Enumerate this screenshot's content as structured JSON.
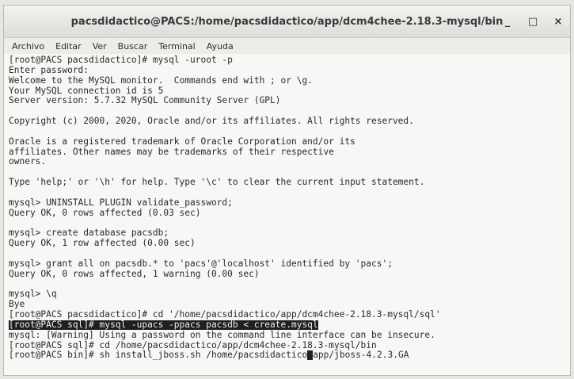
{
  "window": {
    "title": "pacsdidactico@PACS:/home/pacsdidactico/app/dcm4chee-2.18.3-mysql/bin",
    "minimize": "_",
    "maximize": "□",
    "close": "×"
  },
  "menu": [
    "Archivo",
    "Editar",
    "Ver",
    "Buscar",
    "Terminal",
    "Ayuda"
  ],
  "terminal": {
    "lines": [
      "[root@PACS pacsdidactico]# mysql -uroot -p",
      "Enter password:",
      "Welcome to the MySQL monitor.  Commands end with ; or \\g.",
      "Your MySQL connection id is 5",
      "Server version: 5.7.32 MySQL Community Server (GPL)",
      "",
      "Copyright (c) 2000, 2020, Oracle and/or its affiliates. All rights reserved.",
      "",
      "Oracle is a registered trademark of Oracle Corporation and/or its",
      "affiliates. Other names may be trademarks of their respective",
      "owners.",
      "",
      "Type 'help;' or '\\h' for help. Type '\\c' to clear the current input statement.",
      "",
      "mysql> UNINSTALL PLUGIN validate_password;",
      "Query OK, 0 rows affected (0.03 sec)",
      "",
      "mysql> create database pacsdb;",
      "Query OK, 1 row affected (0.00 sec)",
      "",
      "mysql> grant all on pacsdb.* to 'pacs'@'localhost' identified by 'pacs';",
      "Query OK, 0 rows affected, 1 warning (0.00 sec)",
      "",
      "mysql> \\q",
      "Bye",
      "[root@PACS pacsdidactico]# cd '/home/pacsdidactico/app/dcm4chee-2.18.3-mysql/sql'",
      "[root@PACS sql]# mysql -upacs -ppacs pacsdb < create.mysql",
      "mysql: [Warning] Using a password on the command line interface can be insecure.",
      "[root@PACS sql]# cd /home/pacsdidactico/app/dcm4chee-2.18.3-mysql/bin",
      "[root@PACS bin]# sh install_jboss.sh /home/pacsdidactico"
    ],
    "last_line_after_cursor": "app/jboss-4.2.3.GA"
  }
}
